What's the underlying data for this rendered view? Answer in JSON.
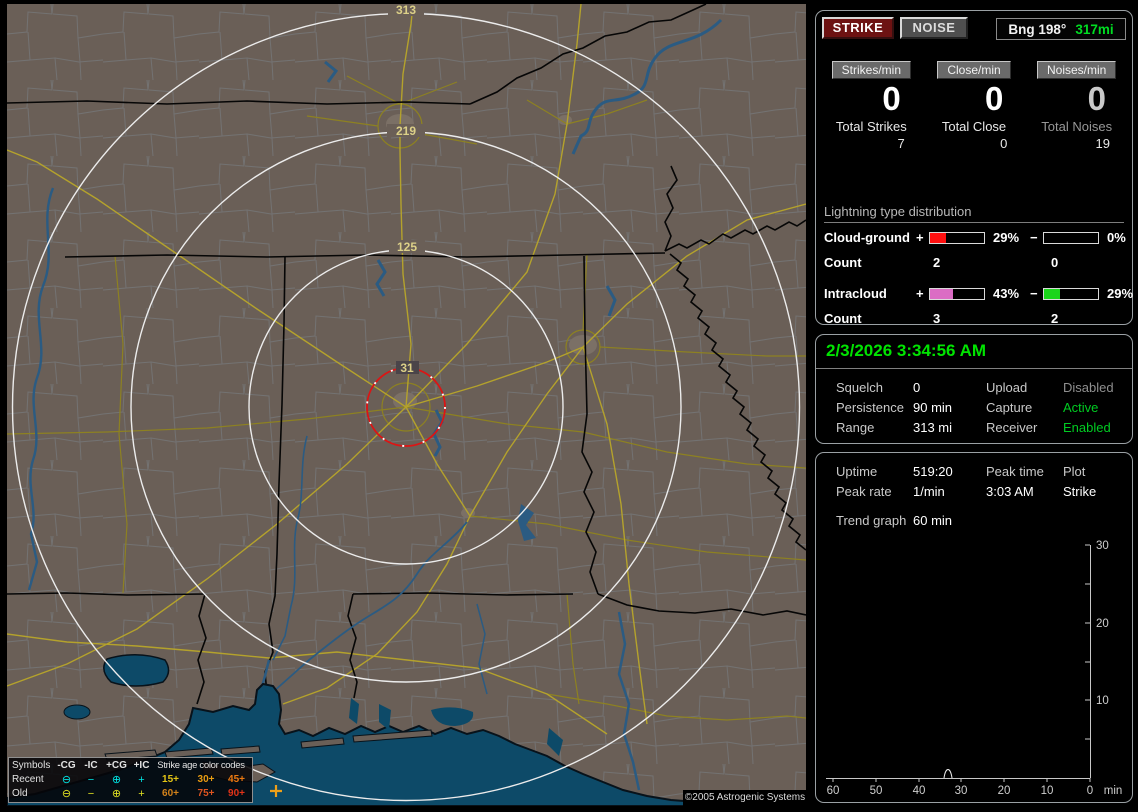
{
  "map": {
    "ring_labels": [
      "313",
      "219",
      "125",
      "31"
    ],
    "copyright": "©2005 Astrogenic Systems",
    "colors": {
      "ring_label": "#dcd088",
      "strike_marker": "#eda019",
      "range_ring": "#ececec",
      "close_ring": "#dd1414",
      "water": "#0d4a68",
      "land": "#6a5f57"
    },
    "legend": {
      "symbols_header": "Symbols",
      "type_headers": [
        "-CG",
        "-IC",
        "+CG",
        "+IC"
      ],
      "age_header": "Strike age color codes",
      "rows": [
        {
          "label": "Recent",
          "symbol_color": "#00e6e6",
          "symbols": [
            "⊖",
            "−",
            "⊕",
            "+"
          ],
          "ages": [
            {
              "text": "15+",
              "color": "#e3c414"
            },
            {
              "text": "30+",
              "color": "#eb9b11"
            },
            {
              "text": "45+",
              "color": "#ee7a11"
            }
          ]
        },
        {
          "label": "Old",
          "symbol_color": "#e0e022",
          "symbols": [
            "⊖",
            "−",
            "⊕",
            "+"
          ],
          "ages": [
            {
              "text": "60+",
              "color": "#d4821a"
            },
            {
              "text": "75+",
              "color": "#dd5420"
            },
            {
              "text": "90+",
              "color": "#e23318"
            }
          ]
        }
      ]
    }
  },
  "toolbar": {
    "strike": "STRIKE",
    "noise": "NOISE",
    "bearing": "Bng 198°",
    "range": "317mi"
  },
  "counters": [
    {
      "header": "Strikes/min",
      "value": "0",
      "value_color": "#ffffff",
      "total_label": "Total Strikes",
      "label_color": "#e8e8e8",
      "total_value": "7"
    },
    {
      "header": "Close/min",
      "value": "0",
      "value_color": "#ffffff",
      "total_label": "Total Close",
      "label_color": "#e8e8e8",
      "total_value": "0"
    },
    {
      "header": "Noises/min",
      "value": "0",
      "value_color": "#c9c9c9",
      "total_label": "Total Noises",
      "label_color": "#979797",
      "total_value": "19"
    }
  ],
  "distribution": {
    "title": "Lightning type distribution",
    "count_label": "Count",
    "plus_sign": "+",
    "minus_sign": "−",
    "rows": [
      {
        "label": "Cloud-ground",
        "pos_pct": "29%",
        "pos_fill": 29,
        "pos_color": "#ff1010",
        "neg_pct": "0%",
        "neg_fill": 0,
        "neg_color": "#1ad51a",
        "pos_count": "2",
        "neg_count": "0"
      },
      {
        "label": "Intracloud",
        "pos_pct": "43%",
        "pos_fill": 43,
        "pos_color": "#db6cc4",
        "neg_pct": "29%",
        "neg_fill": 29,
        "neg_color": "#1ad51a",
        "pos_count": "3",
        "neg_count": "2"
      }
    ]
  },
  "status": {
    "datetime": "2/3/2026 3:34:56 AM",
    "rows": [
      {
        "l1": "Squelch",
        "v1": "0",
        "l2": "Upload",
        "v2": "Disabled",
        "v2_state": "dim"
      },
      {
        "l1": "Persistence",
        "v1": "90 min",
        "l2": "Capture",
        "v2": "Active",
        "v2_state": "grn"
      },
      {
        "l1": "Range",
        "v1": "313 mi",
        "l2": "Receiver",
        "v2": "Enabled",
        "v2_state": "grn"
      }
    ]
  },
  "stats": {
    "uptime_label": "Uptime",
    "uptime": "519:20",
    "peak_rate_label": "Peak rate",
    "peak_rate": "1/min",
    "peak_time_label": "Peak time",
    "peak_time": "3:03 AM",
    "plot_label": "Plot",
    "plot": "Strike",
    "trend_label": "Trend graph",
    "trend_window": "60 min"
  },
  "chart_data": {
    "type": "line",
    "title": "Trend graph (strikes per minute, last 60 minutes)",
    "x_axis": {
      "label": "min",
      "ticks": [
        60,
        50,
        40,
        30,
        20,
        10,
        0
      ],
      "note": "minutes ago, 0 at right"
    },
    "y_axis": {
      "ticks": [
        10,
        20,
        30
      ],
      "range": [
        0,
        30
      ]
    },
    "series": [
      {
        "name": "Strike",
        "points": [
          {
            "minutes_ago": 33,
            "value": 1
          }
        ]
      }
    ],
    "grid": false,
    "legend": false
  }
}
